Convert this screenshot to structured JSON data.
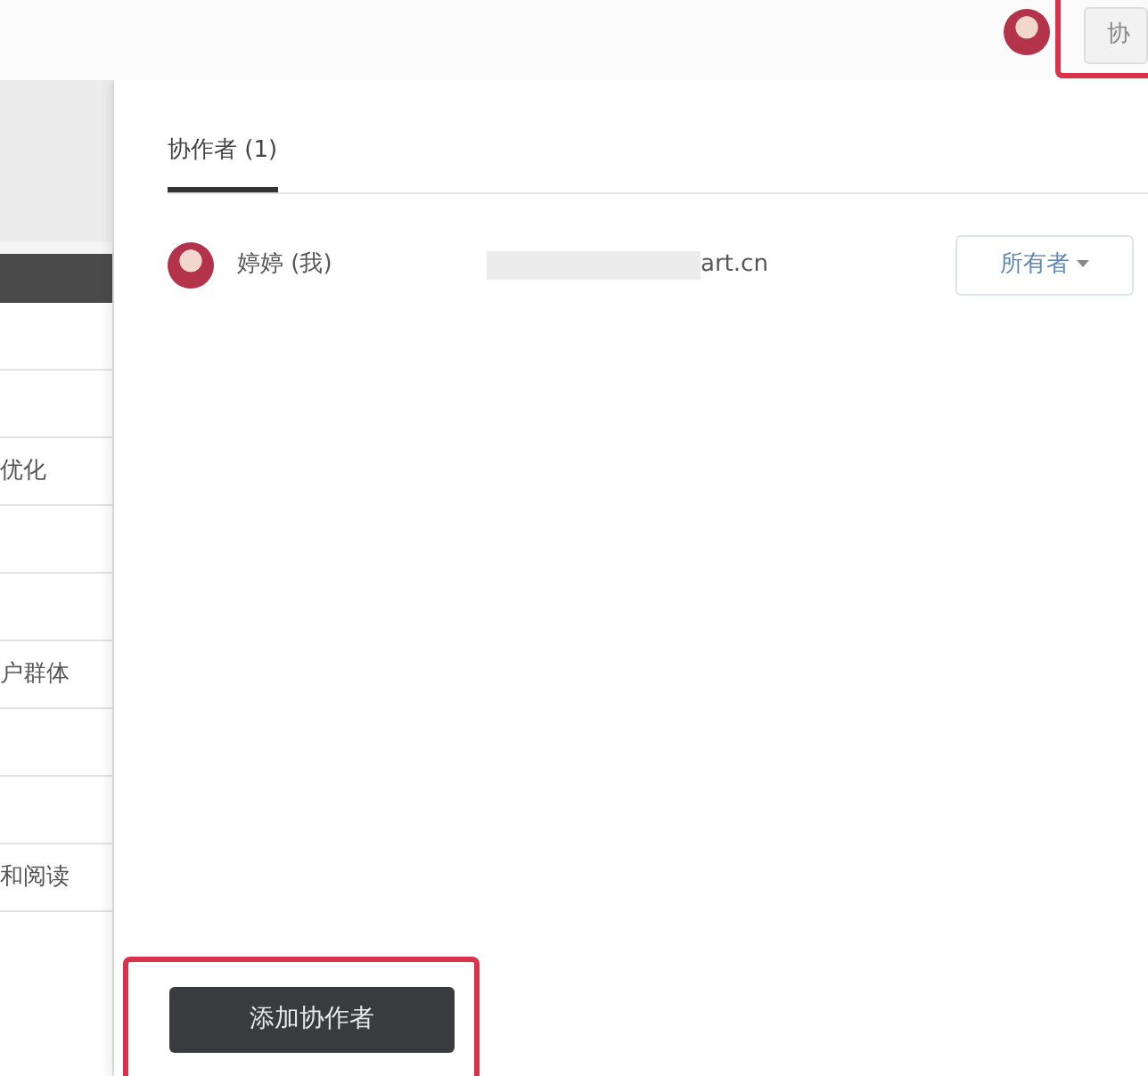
{
  "header": {
    "collab_button": "协"
  },
  "background_list": [
    {
      "kind": "block"
    },
    {
      "kind": "row",
      "text": "优化"
    },
    {
      "kind": "row",
      "text": "户群体"
    },
    {
      "kind": "row",
      "text": "和阅读"
    }
  ],
  "panel": {
    "tabs": [
      {
        "label": "协作者 (1)",
        "selected": true
      }
    ],
    "collaborators": [
      {
        "name": "婷婷 (我)",
        "email": "art.cn",
        "email_redacted": true,
        "role": "所有者"
      }
    ],
    "add_button": "添加协作者"
  }
}
